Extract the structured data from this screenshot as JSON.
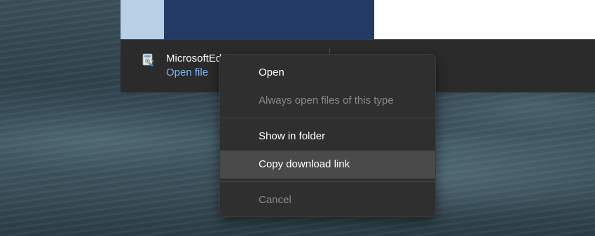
{
  "download_bar": {
    "file_name": "MicrosoftEd",
    "open_file_label": "Open file",
    "file_icon": "installer-package-icon"
  },
  "context_menu": {
    "items": [
      {
        "label": "Open",
        "enabled": true,
        "highlighted": false
      },
      {
        "label": "Always open files of this type",
        "enabled": false,
        "highlighted": false
      },
      {
        "label": "Show in folder",
        "enabled": true,
        "highlighted": false
      },
      {
        "label": "Copy download link",
        "enabled": true,
        "highlighted": true
      },
      {
        "label": "Cancel",
        "enabled": false,
        "highlighted": false
      }
    ]
  },
  "colors": {
    "menu_background": "#2f2f2f",
    "menu_highlight": "#4a4a4a",
    "link": "#7cb4f0",
    "disabled_text": "#8a8a8a"
  }
}
